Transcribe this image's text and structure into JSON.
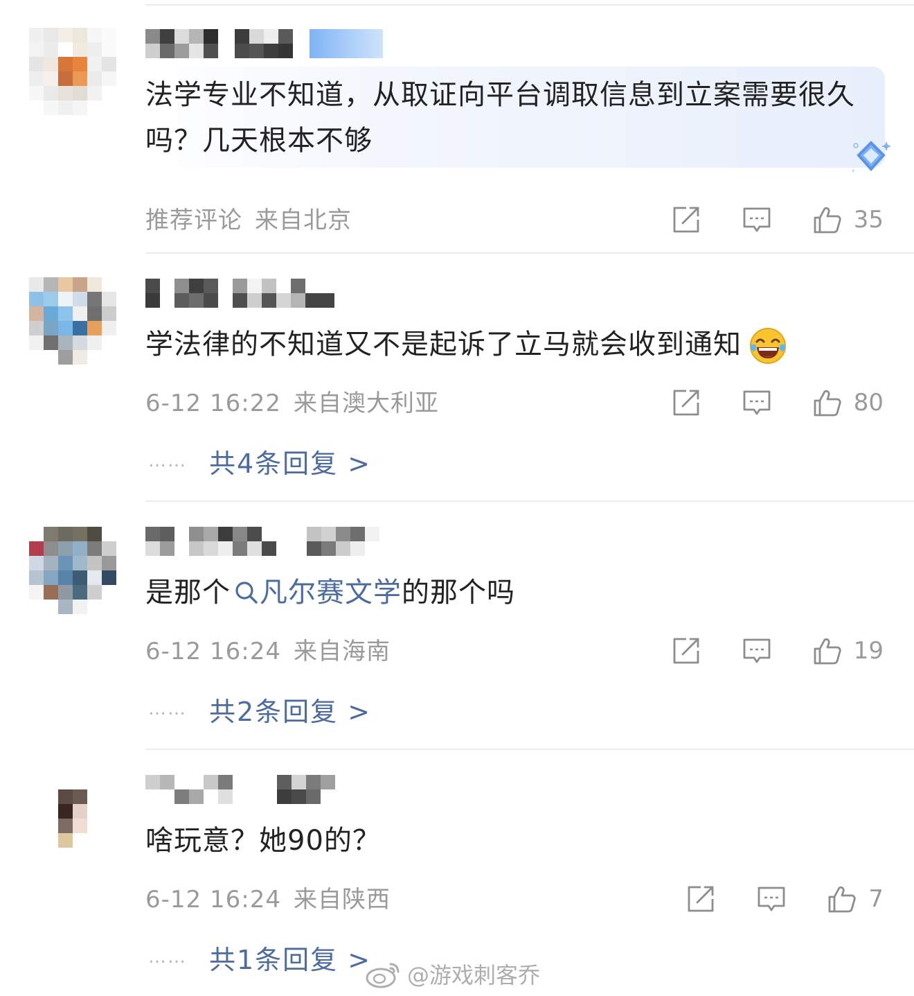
{
  "comments": [
    {
      "text": "法学专业不知道，从取证向平台调取信息到立案需要很久吗？几天根本不够",
      "meta_label": "推荐评论",
      "location": "来自北京",
      "likes": "35",
      "highlighted": true
    },
    {
      "text": "学法律的不知道又不是起诉了立马就会收到通知",
      "time": "6-12 16:22",
      "location": "来自澳大利亚",
      "likes": "80",
      "replies": "共4条回复 >",
      "emoji": "laugh-cry-emoji"
    },
    {
      "text_before": "是那个",
      "topic": "凡尔赛文学",
      "text_after": "的那个吗",
      "time": "6-12 16:24",
      "location": "来自海南",
      "likes": "19",
      "replies": "共2条回复 >"
    },
    {
      "text": "啥玩意？她90的？",
      "time": "6-12 16:24",
      "location": "来自陕西",
      "likes": "7",
      "replies": "共1条回复 >"
    }
  ],
  "reply_dots": "……",
  "watermark": "@游戏刺客乔",
  "icons": {
    "share": "share-icon",
    "comment": "comment-icon",
    "like": "thumbs-up-icon",
    "search": "search-icon",
    "weibo": "weibo-logo-icon",
    "badge": "diamond-badge-icon"
  },
  "colors": {
    "text": "#222222",
    "meta": "#9a9a9a",
    "link": "#4d6c9e",
    "divider": "#ececec"
  }
}
